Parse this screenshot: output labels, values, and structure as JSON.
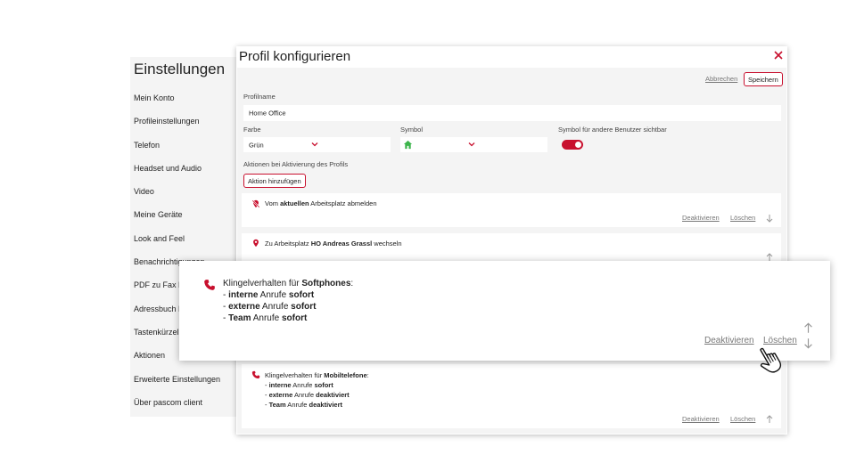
{
  "settings": {
    "title": "Einstellungen",
    "items": [
      "Mein Konto",
      "Profileinstellungen",
      "Telefon",
      "Headset und Audio",
      "Video",
      "Meine Geräte",
      "Look and Feel",
      "Benachrichtigungen",
      "PDF zu Fax Ei",
      "Adressbuch E",
      "Tastenkürzel",
      "Aktionen",
      "Erweiterte Einstellungen",
      "Über pascom client"
    ]
  },
  "modal": {
    "title": "Profil konfigurieren",
    "cancel_label": "Abbrechen",
    "save_label": "Speichern",
    "profile_name_label": "Profilname",
    "profile_name_value": "Home Office",
    "color_label": "Farbe",
    "color_value": "Grün",
    "symbol_label": "Symbol",
    "symbol_icon": "home-icon",
    "visible_label": "Symbol für andere Benutzer sichtbar",
    "visible_on": true,
    "actions_label": "Aktionen bei Aktivierung des Profils",
    "add_action_label": "Aktion hinzufügen",
    "deactivate_label": "Deaktivieren",
    "delete_label": "Löschen",
    "actions": [
      {
        "icon": "location-off-icon",
        "pre": "Vom ",
        "bold": "aktuellen",
        "post": " Arbeitsplatz abmelden"
      },
      {
        "icon": "location-pin-icon",
        "pre": "Zu Arbeitsplatz ",
        "bold": "HO Andreas Grassl",
        "post": " wechseln"
      },
      {
        "icon": "phone-icon",
        "pre": "Klingelverhalten für ",
        "bold": "Mobiltelefone",
        "post": ":",
        "lines": [
          {
            "pre": "- ",
            "b1": "interne",
            "mid": " Anrufe ",
            "b2": "sofort"
          },
          {
            "pre": "- ",
            "b1": "externe",
            "mid": " Anrufe ",
            "b2": "deaktiviert"
          },
          {
            "pre": "- ",
            "b1": "Team",
            "mid": " Anrufe ",
            "b2": "deaktiviert"
          }
        ]
      }
    ],
    "zoom_action": {
      "icon": "phone-icon",
      "pre": "Klingelverhalten für ",
      "bold": "Softphones",
      "post": ":",
      "lines": [
        {
          "pre": "- ",
          "b1": "interne",
          "mid": " Anrufe ",
          "b2": "sofort"
        },
        {
          "pre": "- ",
          "b1": "externe",
          "mid": " Anrufe ",
          "b2": "sofort"
        },
        {
          "pre": "- ",
          "b1": "Team",
          "mid": " Anrufe ",
          "b2": "sofort"
        }
      ]
    }
  },
  "colors": {
    "accent": "#c8102e",
    "home_icon": "#3cb44b"
  }
}
